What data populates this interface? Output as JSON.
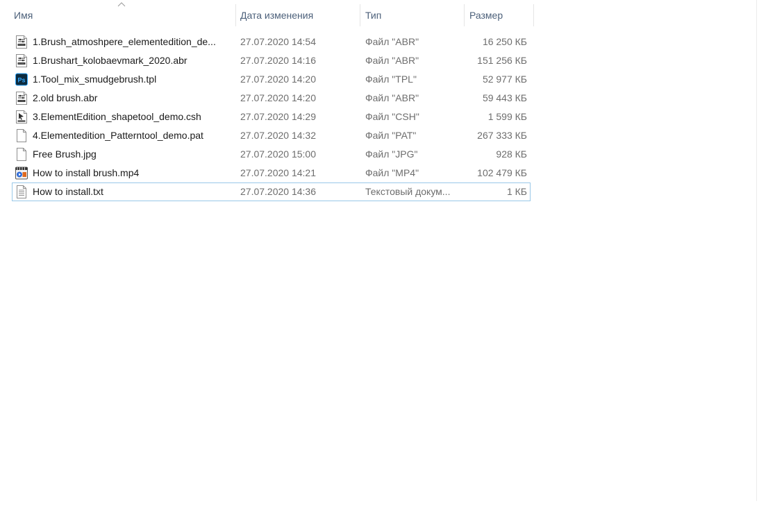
{
  "columns": {
    "name": "Имя",
    "date": "Дата изменения",
    "type": "Тип",
    "size": "Размер"
  },
  "files": [
    {
      "name": "1.Brush_atmoshpere_elementedition_de...",
      "date": "27.07.2020 14:54",
      "type": "Файл \"ABR\"",
      "size": "16 250 КБ",
      "icon": "brush-preset-icon"
    },
    {
      "name": "1.Brushart_kolobaevmark_2020.abr",
      "date": "27.07.2020 14:16",
      "type": "Файл \"ABR\"",
      "size": "151 256 КБ",
      "icon": "brush-preset-icon"
    },
    {
      "name": "1.Tool_mix_smudgebrush.tpl",
      "date": "27.07.2020 14:20",
      "type": "Файл \"TPL\"",
      "size": "52 977 КБ",
      "icon": "photoshop-icon"
    },
    {
      "name": "2.old brush.abr",
      "date": "27.07.2020 14:20",
      "type": "Файл \"ABR\"",
      "size": "59 443 КБ",
      "icon": "brush-preset-icon"
    },
    {
      "name": "3.ElementEdition_shapetool_demo.csh",
      "date": "27.07.2020 14:29",
      "type": "Файл \"CSH\"",
      "size": "1 599 КБ",
      "icon": "shape-preset-icon"
    },
    {
      "name": "4.Elementedition_Patterntool_demo.pat",
      "date": "27.07.2020 14:32",
      "type": "Файл \"PAT\"",
      "size": "267 333 КБ",
      "icon": "blank-file-icon"
    },
    {
      "name": "Free Brush.jpg",
      "date": "27.07.2020 15:00",
      "type": "Файл \"JPG\"",
      "size": "928 КБ",
      "icon": "blank-file-icon"
    },
    {
      "name": "How to install brush.mp4",
      "date": "27.07.2020 14:21",
      "type": "Файл \"MP4\"",
      "size": "102 479 КБ",
      "icon": "video-player-icon"
    },
    {
      "name": "How to install.txt",
      "date": "27.07.2020 14:36",
      "type": "Текстовый докум...",
      "size": "1 КБ",
      "icon": "text-file-icon"
    }
  ],
  "focused_index": 8,
  "sort": {
    "column": "name",
    "direction": "ascending"
  }
}
